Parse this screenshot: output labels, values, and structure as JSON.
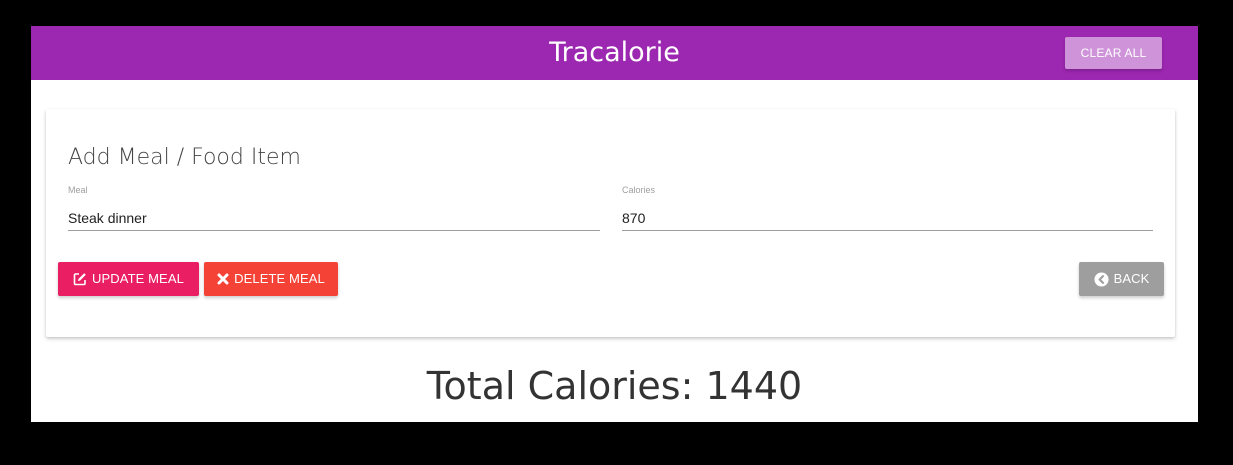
{
  "navbar": {
    "brand": "Tracalorie",
    "clear_all_label": "CLEAR ALL"
  },
  "card": {
    "title": "Add Meal / Food Item",
    "meal_field": {
      "label": "Meal",
      "value": "Steak dinner"
    },
    "calories_field": {
      "label": "Calories",
      "value": "870"
    },
    "buttons": {
      "update_label": "UPDATE MEAL",
      "delete_label": "DELETE MEAL",
      "back_label": "BACK"
    }
  },
  "total": {
    "text": "Total Calories: 1440"
  },
  "colors": {
    "navbar": "#9c27b0",
    "clear_all": "#ce93d8",
    "update": "#e91e63",
    "delete": "#f44336",
    "back": "#9e9e9e"
  },
  "icons": {
    "update": "pencil-square-icon",
    "delete": "close-icon",
    "back": "chevron-circle-left-icon"
  }
}
